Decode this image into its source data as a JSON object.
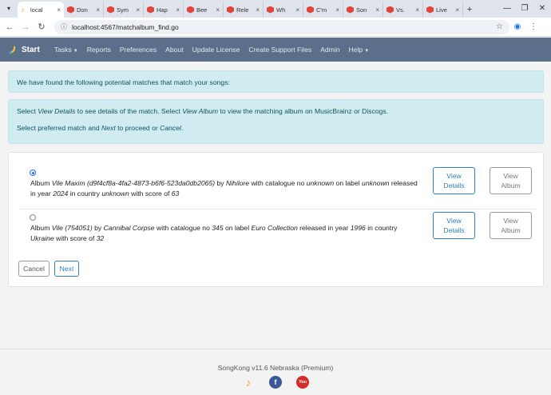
{
  "browser": {
    "active_tab_title": "local",
    "tabs": [
      "Don",
      "Sym",
      "Hap",
      "Bee",
      "Rele",
      "Wh",
      "C'm",
      "Son",
      "Vs.",
      "Live"
    ],
    "url": "localhost:4567/matchalbum_find.go"
  },
  "navbar": {
    "brand": "Start",
    "items": [
      "Tasks",
      "Reports",
      "Preferences",
      "About",
      "Update License",
      "Create Support Files",
      "Admin",
      "Help"
    ]
  },
  "alert1": "We have found the following potential matches that match your songs:",
  "alert2": {
    "line1_a": "Select ",
    "line1_em1": "View Details",
    "line1_b": " to see details of the match. Select ",
    "line1_em2": "View Album",
    "line1_c": " to view the matching album on MusicBrainz or Discogs.",
    "line2_a": "Select preferred match and ",
    "line2_em1": "Next",
    "line2_b": " to proceed or ",
    "line2_em2": "Cancel",
    "line2_c": "."
  },
  "matches": [
    {
      "selected": true,
      "p1": "Album ",
      "album": "Vile Maxim (d9f4cf8a-4fa2-4873-b6f6-523da0db2065)",
      "p2": " by ",
      "artist": "Nihilore",
      "p3": " with catalogue no ",
      "catalogue": "unknown",
      "p4": " on label ",
      "label": "unknown",
      "p5": " released in year ",
      "year": "2024",
      "p6": " in country ",
      "country": "unknown",
      "p7": " with score of ",
      "score": "63"
    },
    {
      "selected": false,
      "p1": "Album ",
      "album": "Vile (754051)",
      "p2": " by ",
      "artist": "Cannibal Corpse",
      "p3": " with catalogue no ",
      "catalogue": "345",
      "p4": " on label ",
      "label": "Euro Collection",
      "p5": " released in year ",
      "year": "1996",
      "p6": " in country ",
      "country": "Ukraine",
      "p7": " with score of ",
      "score": "32"
    }
  ],
  "buttons": {
    "view_details_l1": "View",
    "view_details_l2": "Details",
    "view_album_l1": "View",
    "view_album_l2": "Album",
    "cancel": "Cancel",
    "next": "Next"
  },
  "footer": "SongKong v11.6 Nebraska (Premium)",
  "icons": {
    "youtube_text": "You"
  }
}
